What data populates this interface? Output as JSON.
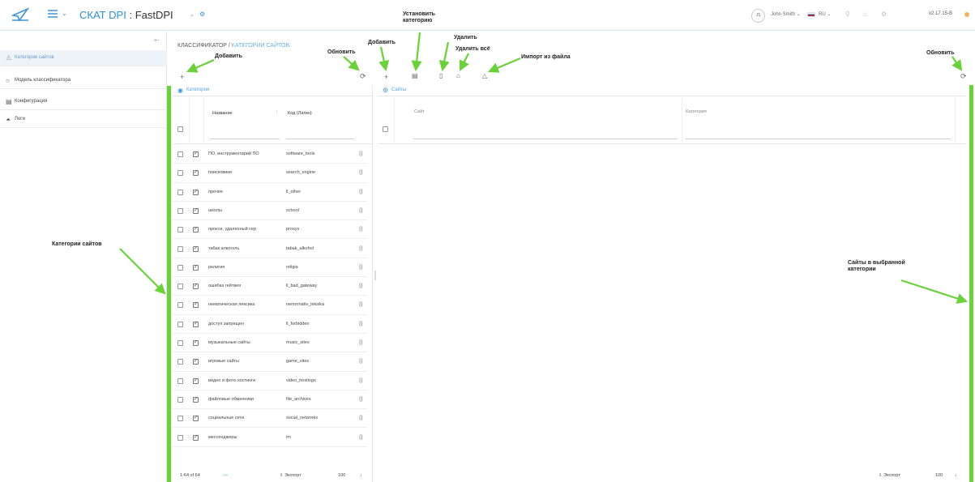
{
  "header": {
    "app_name": "СКАТ DPI",
    "separator": " : ",
    "product": "FastDPI",
    "user_initials": "JS",
    "user_name": "John Smith ⌄",
    "language": "RU ⌄",
    "version": "v2.17.15-B"
  },
  "sidebar": {
    "items": [
      {
        "label": "Категории сайтов",
        "icon": "tag-icon"
      },
      {
        "label": "Модель классификатора",
        "icon": "circle-icon"
      },
      {
        "label": "Конфигурация",
        "icon": "config-icon"
      },
      {
        "label": "Логи",
        "icon": "chart-icon"
      }
    ]
  },
  "breadcrumb": {
    "part1": "КЛАССИФИКАТОР / ",
    "part2": "КАТЕГОРИИ САЙТОВ"
  },
  "categories_panel": {
    "title": "Категории",
    "col_name": "Название",
    "col_code": "Код (Латин)",
    "rows": [
      {
        "name": "ПО, инструментарий ПО",
        "code": "software_tools"
      },
      {
        "name": "поисковики",
        "code": "search_engine"
      },
      {
        "name": "прочее",
        "code": "ll_other"
      },
      {
        "name": "школы",
        "code": "school"
      },
      {
        "name": "прокси, удаленный сер",
        "code": "proxys"
      },
      {
        "name": "табак алкоголь",
        "code": "tabak_alkohol"
      },
      {
        "name": "религия",
        "code": "religia"
      },
      {
        "name": "ошибка гейтвея",
        "code": "ll_bad_gateway"
      },
      {
        "name": "нематическая лексика",
        "code": "nenormativ_leksika"
      },
      {
        "name": "доступ запрещен",
        "code": "ll_forbidden"
      },
      {
        "name": "музыкальные сайты",
        "code": "music_sites"
      },
      {
        "name": "игровые сайты",
        "code": "game_sites"
      },
      {
        "name": "видео и фото хостинги",
        "code": "video_hostings"
      },
      {
        "name": "файловые обменники",
        "code": "file_archives"
      },
      {
        "name": "социальные сети",
        "code": "social_networks"
      },
      {
        "name": "мессенджеры",
        "code": "im"
      }
    ],
    "pager": "1-64 of 64",
    "pager_arrow": "»»",
    "export_label": "Экспорт",
    "page_size": "100"
  },
  "sites_panel": {
    "title": "Сайты",
    "col_site": "Сайт",
    "col_category": "Категория",
    "export_label": "Экспорт",
    "page_size": "100"
  },
  "annotations": {
    "add_left": "Добавить",
    "refresh_left": "Обновить",
    "add_right": "Добавить",
    "set_category": "Установить\nкатегорию",
    "delete": "Удалить",
    "delete_all": "Удалить всё",
    "import_file": "Импорт из файла",
    "refresh_right": "Обновить",
    "site_categories": "Категории сайтов",
    "sites_in_category": "Сайты в выбранной\nкатегории"
  },
  "colors": {
    "accent": "#2e8fd0",
    "annotation_green": "#6bd13a",
    "link": "#6aaee0"
  }
}
